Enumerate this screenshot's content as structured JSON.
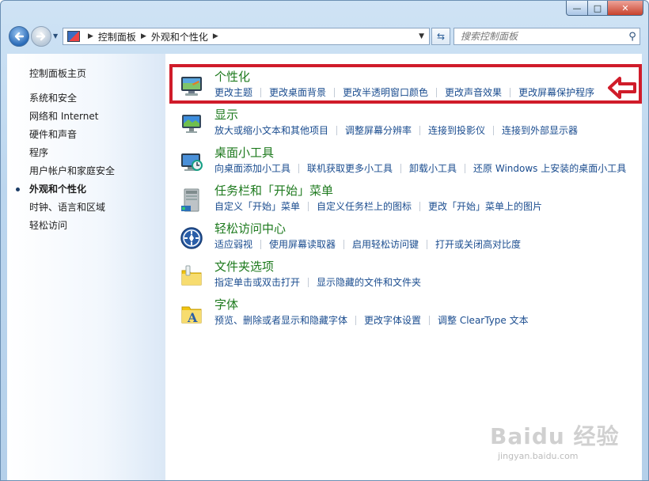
{
  "window": {
    "controls": {
      "minimize": "—",
      "maximize": "□",
      "close": "✕"
    }
  },
  "nav": {
    "back_icon": "back-arrow-icon",
    "forward_icon": "forward-arrow-icon",
    "breadcrumb": [
      "控制面板",
      "外观和个性化"
    ],
    "search_placeholder": "搜索控制面板"
  },
  "sidebar": {
    "home": "控制面板主页",
    "items": [
      {
        "label": "系统和安全",
        "active": false
      },
      {
        "label": "网络和 Internet",
        "active": false
      },
      {
        "label": "硬件和声音",
        "active": false
      },
      {
        "label": "程序",
        "active": false
      },
      {
        "label": "用户帐户和家庭安全",
        "active": false
      },
      {
        "label": "外观和个性化",
        "active": true
      },
      {
        "label": "时钟、语言和区域",
        "active": false
      },
      {
        "label": "轻松访问",
        "active": false
      }
    ]
  },
  "categories": [
    {
      "title": "个性化",
      "icon": "personalization-icon",
      "links": [
        "更改主题",
        "更改桌面背景",
        "更改半透明窗口颜色",
        "更改声音效果",
        "更改屏幕保护程序"
      ]
    },
    {
      "title": "显示",
      "icon": "display-icon",
      "links": [
        "放大或缩小文本和其他项目",
        "调整屏幕分辨率",
        "连接到投影仪",
        "连接到外部显示器"
      ]
    },
    {
      "title": "桌面小工具",
      "icon": "gadgets-icon",
      "links": [
        "向桌面添加小工具",
        "联机获取更多小工具",
        "卸载小工具",
        "还原 Windows 上安装的桌面小工具"
      ]
    },
    {
      "title": "任务栏和「开始」菜单",
      "icon": "taskbar-icon",
      "links": [
        "自定义「开始」菜单",
        "自定义任务栏上的图标",
        "更改「开始」菜单上的图片"
      ]
    },
    {
      "title": "轻松访问中心",
      "icon": "ease-of-access-icon",
      "links": [
        "适应弱视",
        "使用屏幕读取器",
        "启用轻松访问键",
        "打开或关闭高对比度"
      ]
    },
    {
      "title": "文件夹选项",
      "icon": "folder-options-icon",
      "links": [
        "指定单击或双击打开",
        "显示隐藏的文件和文件夹"
      ]
    },
    {
      "title": "字体",
      "icon": "fonts-icon",
      "links": [
        "预览、删除或者显示和隐藏字体",
        "更改字体设置",
        "调整 ClearType 文本"
      ]
    }
  ],
  "annotation_color": "#d01c2a",
  "watermark": {
    "brand": "Baidu 经验",
    "url": "jingyan.baidu.com"
  }
}
